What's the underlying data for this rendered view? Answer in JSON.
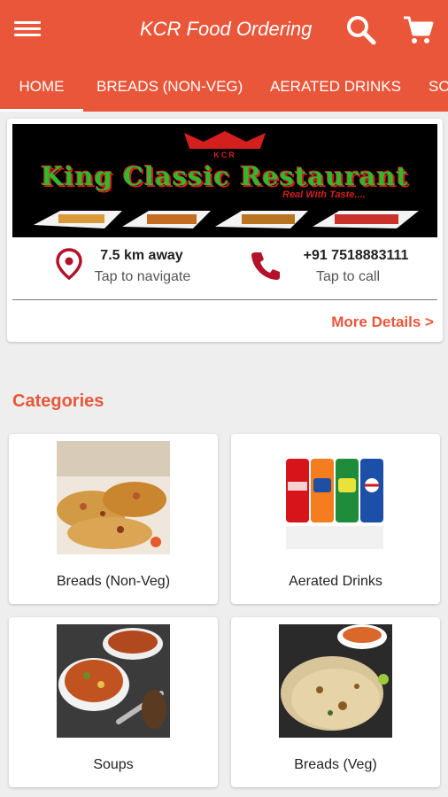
{
  "app": {
    "title": "KCR Food Ordering"
  },
  "tabs": [
    "HOME",
    "BREADS (NON-VEG)",
    "AERATED DRINKS",
    "SO"
  ],
  "colors": {
    "primary": "#ea563a",
    "background": "#eeeeee"
  },
  "icons": {
    "menu": "menu-icon",
    "search": "search-icon",
    "cart": "cart-icon",
    "location": "location-pin-icon",
    "phone": "phone-icon"
  },
  "restaurant": {
    "banner_mark": "KCR",
    "banner_name": "King Classic Restaurant",
    "banner_tagline": "Real With Taste....",
    "distance": "7.5 km away",
    "navigate_label": "Tap to navigate",
    "phone": "+91 7518883111",
    "call_label": "Tap to call",
    "more_details": "More Details >"
  },
  "categories": {
    "title": "Categories",
    "items": [
      {
        "label": "Breads (Non-Veg)"
      },
      {
        "label": "Aerated Drinks"
      },
      {
        "label": "Soups"
      },
      {
        "label": "Breads (Veg)"
      }
    ]
  }
}
